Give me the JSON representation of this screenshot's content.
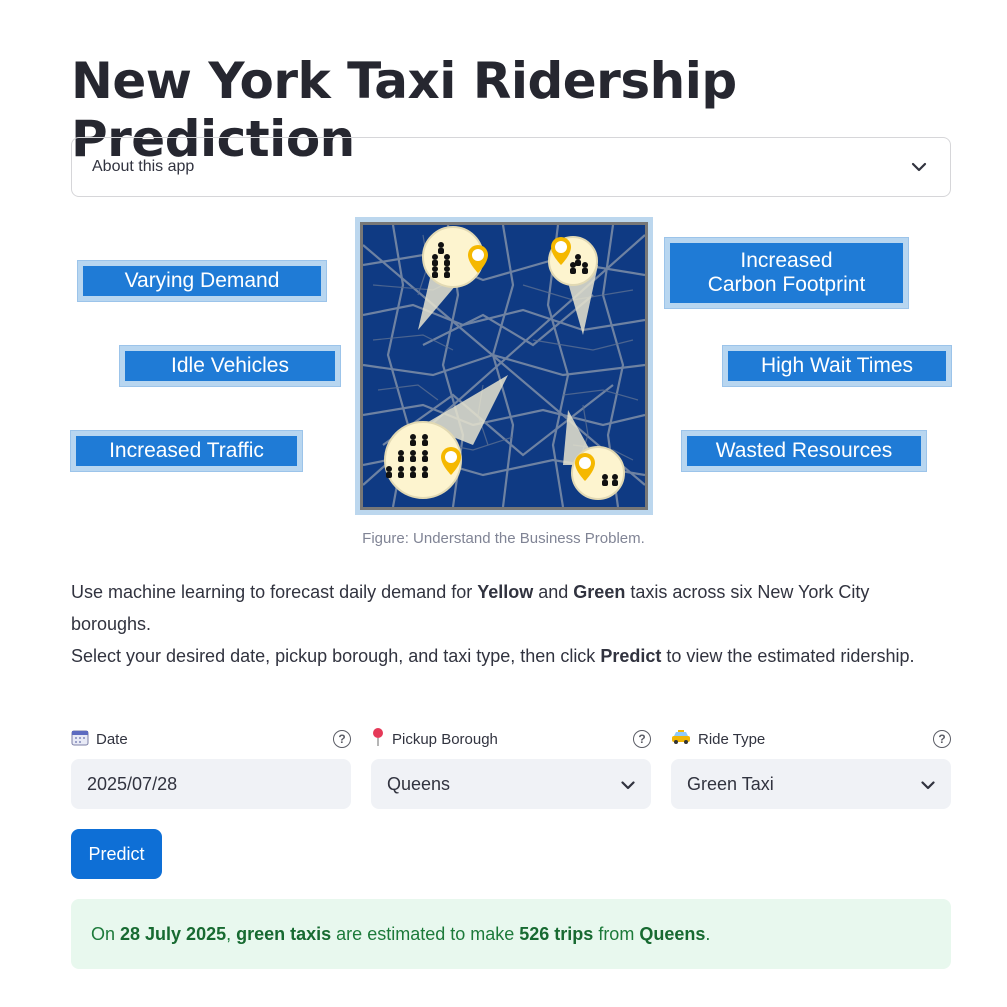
{
  "page": {
    "title": "New York Taxi Ridership Prediction"
  },
  "expander": {
    "label": "About this app"
  },
  "figure": {
    "labels": {
      "varying_demand": "Varying Demand",
      "idle_vehicles": "Idle Vehicles",
      "increased_traffic": "Increased Traffic",
      "carbon_line1": "Increased",
      "carbon_line2": "Carbon Footprint",
      "high_wait": "High Wait Times",
      "wasted": "Wasted Resources"
    },
    "caption": "Figure: Understand the Business Problem."
  },
  "description": {
    "p1_a": "Use machine learning to forecast daily demand for ",
    "p1_yellow": "Yellow",
    "p1_b": " and ",
    "p1_green": "Green",
    "p1_c": " taxis across six New York City boroughs.",
    "p2_a": "Select your desired date, pickup borough, and taxi type, then click ",
    "p2_predict": "Predict",
    "p2_b": " to view the estimated ridership."
  },
  "form": {
    "date": {
      "label": "Date",
      "value": "2025/07/28",
      "icon": "calendar-icon"
    },
    "borough": {
      "label": "Pickup Borough",
      "value": "Queens",
      "icon": "pushpin-icon"
    },
    "ride": {
      "label": "Ride Type",
      "value": "Green Taxi",
      "icon": "taxi-icon"
    },
    "help_glyph": "?"
  },
  "predict_button": {
    "label": "Predict"
  },
  "result": {
    "a": "On ",
    "date": "28 July 2025",
    "b": ", ",
    "taxi": "green taxis",
    "c": " are estimated to make ",
    "trips": "526 trips",
    "d": " from ",
    "borough": "Queens",
    "e": "."
  },
  "colors": {
    "accent": "#0e6fd6",
    "label_blue": "#1f7bd6",
    "map_blue": "#0f3a83",
    "success_bg": "#e8f8ee",
    "success_text": "#1c7a3a"
  }
}
